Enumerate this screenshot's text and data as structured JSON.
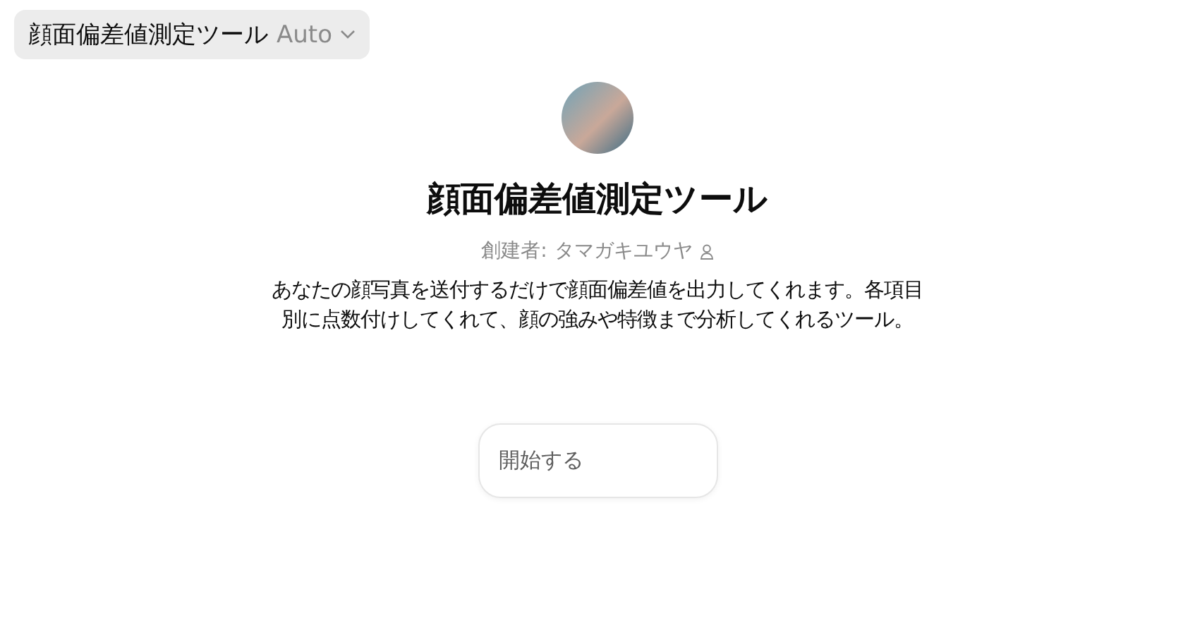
{
  "model_selector": {
    "name": "顔面偏差値測定ツール",
    "mode": "Auto"
  },
  "profile": {
    "title": "顔面偏差値測定ツール",
    "creator_label": "創建者:",
    "creator_name": "タマガキユウヤ",
    "description": "あなたの顔写真を送付するだけで顔面偏差値を出力してくれます。各項目別に点数付けしてくれて、顔の強みや特徴まで分析してくれるツール。"
  },
  "starters": [
    "開始する"
  ]
}
